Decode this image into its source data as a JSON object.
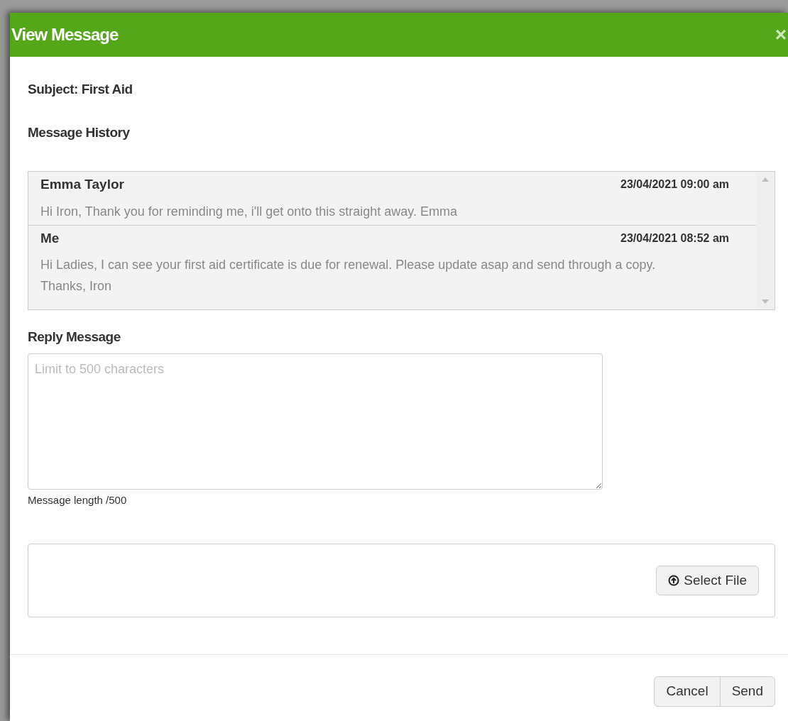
{
  "dialog": {
    "title": "View Message",
    "close": "×"
  },
  "subject": "Subject: First Aid",
  "history_label": "Message History",
  "messages": [
    {
      "sender": "Emma Taylor",
      "time": "23/04/2021 09:00 am",
      "body": "Hi Iron, Thank you for reminding me, i'll get onto this straight away. Emma"
    },
    {
      "sender": "Me",
      "time": "23/04/2021 08:52 am",
      "body": "Hi Ladies, I can see your first aid certificate is due for renewal. Please update asap and send through a copy. Thanks, Iron"
    }
  ],
  "reply": {
    "label": "Reply Message",
    "placeholder": "Limit to 500 characters",
    "hint": "Message length /500"
  },
  "attach_button": "Select File",
  "footer_buttons": [
    "Cancel",
    "Send"
  ]
}
